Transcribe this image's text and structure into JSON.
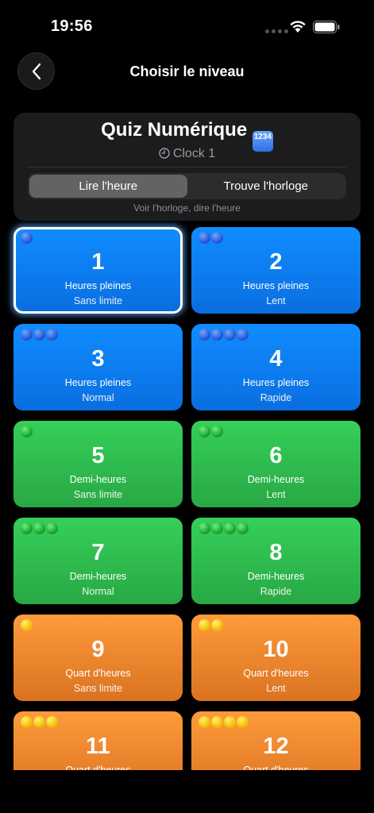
{
  "status": {
    "time": "19:56"
  },
  "nav": {
    "title": "Choisir le niveau"
  },
  "header": {
    "title": "Quiz Numérique",
    "title_emoji": "1234",
    "clock_label": "Clock 1",
    "tabs": [
      {
        "label": "Lire l'heure",
        "active": true
      },
      {
        "label": "Trouve l'horloge",
        "active": false
      }
    ],
    "caption": "Voir l'horloge, dire l'heure"
  },
  "levels": [
    {
      "number": "1",
      "type": "Heures pleines",
      "speed": "Sans limite",
      "color": "blue",
      "dots": 1,
      "selected": true
    },
    {
      "number": "2",
      "type": "Heures pleines",
      "speed": "Lent",
      "color": "blue",
      "dots": 2,
      "selected": false
    },
    {
      "number": "3",
      "type": "Heures pleines",
      "speed": "Normal",
      "color": "blue",
      "dots": 3,
      "selected": false
    },
    {
      "number": "4",
      "type": "Heures pleines",
      "speed": "Rapide",
      "color": "blue",
      "dots": 4,
      "selected": false
    },
    {
      "number": "5",
      "type": "Demi-heures",
      "speed": "Sans limite",
      "color": "green",
      "dots": 1,
      "selected": false
    },
    {
      "number": "6",
      "type": "Demi-heures",
      "speed": "Lent",
      "color": "green",
      "dots": 2,
      "selected": false
    },
    {
      "number": "7",
      "type": "Demi-heures",
      "speed": "Normal",
      "color": "green",
      "dots": 3,
      "selected": false
    },
    {
      "number": "8",
      "type": "Demi-heures",
      "speed": "Rapide",
      "color": "green",
      "dots": 4,
      "selected": false
    },
    {
      "number": "9",
      "type": "Quart d'heures",
      "speed": "Sans limite",
      "color": "orange",
      "dots": 1,
      "selected": false
    },
    {
      "number": "10",
      "type": "Quart d'heures",
      "speed": "Lent",
      "color": "orange",
      "dots": 2,
      "selected": false
    },
    {
      "number": "11",
      "type": "Quart d'heures",
      "speed": "",
      "color": "orange",
      "dots": 3,
      "selected": false
    },
    {
      "number": "12",
      "type": "Quart d'heures",
      "speed": "",
      "color": "orange",
      "dots": 4,
      "selected": false
    }
  ],
  "colors": {
    "blue": "#0a84ff",
    "green": "#30c452",
    "orange": "#f5862e",
    "background": "#000000"
  }
}
